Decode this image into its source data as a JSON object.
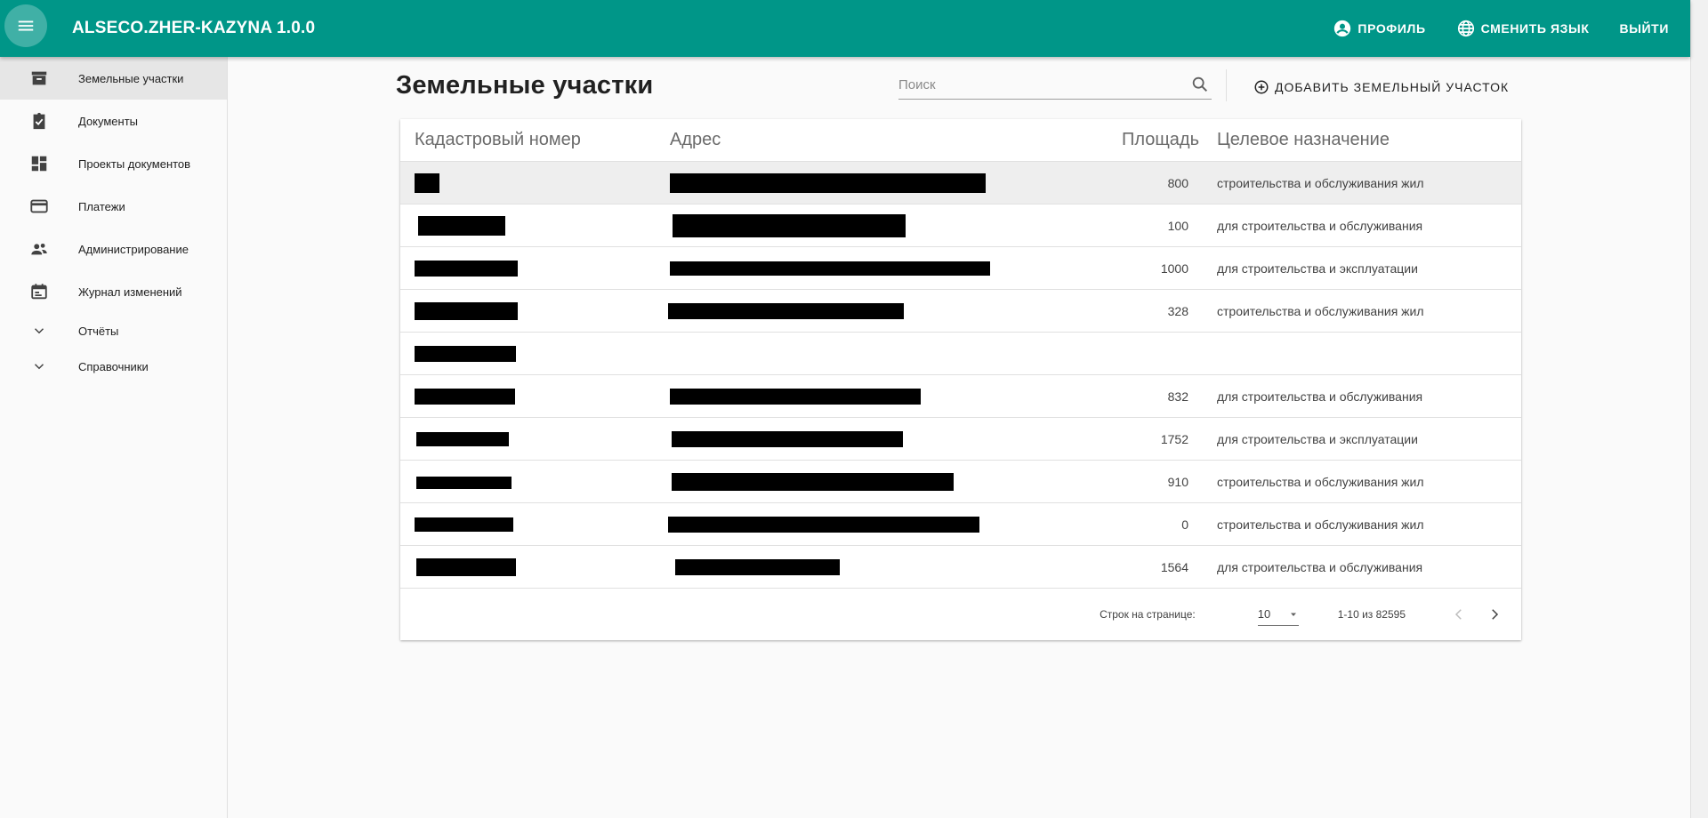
{
  "app": {
    "title": "ALSECO.ZHER-KAZYNA 1.0.0"
  },
  "topbar": {
    "profile_label": "ПРОФИЛЬ",
    "language_label": "СМЕНИТЬ ЯЗЫК",
    "logout_label": "ВЫЙТИ"
  },
  "colors": {
    "primary": "#009688",
    "active_nav": "#e6e6e6"
  },
  "sidebar": {
    "items": [
      {
        "label": "Земельные участки",
        "icon": "archive-icon",
        "active": true
      },
      {
        "label": "Документы",
        "icon": "assignment-check-icon"
      },
      {
        "label": "Проекты документов",
        "icon": "dashboard-icon"
      },
      {
        "label": "Платежи",
        "icon": "credit-card-icon"
      },
      {
        "label": "Администрирование",
        "icon": "people-icon"
      },
      {
        "label": "Журнал изменений",
        "icon": "calendar-icon"
      },
      {
        "label": "Отчёты",
        "icon": "chevron-down-icon"
      },
      {
        "label": "Справочники",
        "icon": "chevron-down-icon"
      }
    ]
  },
  "page": {
    "title": "Земельные участки",
    "search_placeholder": "Поиск",
    "add_label": "ДОБАВИТЬ ЗЕМЕЛЬНЫЙ УЧАСТОК"
  },
  "table": {
    "headers": [
      "Кадастровый номер",
      "Адрес",
      "Площадь",
      "Целевое назначение"
    ],
    "rows": [
      {
        "area": "800",
        "purpose": "строительства и обслуживания жил",
        "highlighted": true
      },
      {
        "area": "100",
        "purpose": "для строительства и обслуживания"
      },
      {
        "area": "1000",
        "purpose": "для строительства и эксплуатации"
      },
      {
        "area": "328",
        "purpose": "строительства и обслуживания жил"
      },
      {
        "area": "",
        "purpose": ""
      },
      {
        "area": "832",
        "purpose": "для строительства и обслуживания"
      },
      {
        "area": "1752",
        "purpose": "для строительства и эксплуатации"
      },
      {
        "area": "910",
        "purpose": "строительства и обслуживания жил"
      },
      {
        "area": "0",
        "purpose": "строительства и обслуживания жил"
      },
      {
        "area": "1564",
        "purpose": "для строительства и обслуживания"
      }
    ]
  },
  "pagination": {
    "rows_per_page_label": "Строк на странице:",
    "rows_per_page_value": "10",
    "range": "1-10 из 82595"
  }
}
